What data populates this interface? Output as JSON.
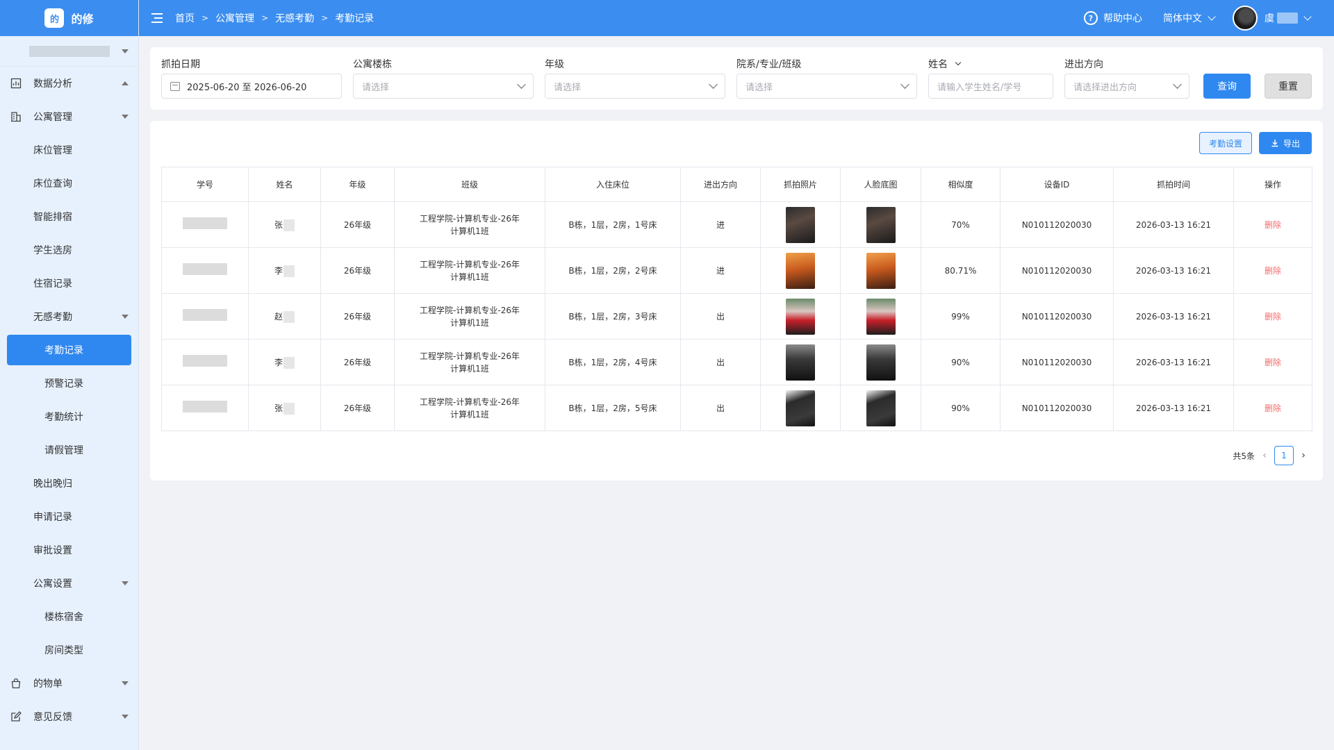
{
  "app": {
    "logo_icon": "的",
    "name": "的修"
  },
  "colors": {
    "primary": "#2f88f0",
    "header": "#3b8ef0",
    "danger": "#f56c6c",
    "sidebar_bg": "#e7f1fd"
  },
  "breadcrumb": [
    "首页",
    "公寓管理",
    "无感考勤",
    "考勤记录"
  ],
  "header": {
    "help": "帮助中心",
    "language": "简体中文",
    "user_name": "虞"
  },
  "sidebar": {
    "items": [
      {
        "label": "数据分析",
        "level": 1,
        "icon": "chart-icon",
        "expanded": true
      },
      {
        "label": "公寓管理",
        "level": 1,
        "icon": "building-icon",
        "expanded": true
      },
      {
        "label": "床位管理",
        "level": 1
      },
      {
        "label": "床位查询",
        "level": 1
      },
      {
        "label": "智能排宿",
        "level": 1
      },
      {
        "label": "学生选房",
        "level": 1
      },
      {
        "label": "住宿记录",
        "level": 1
      },
      {
        "label": "无感考勤",
        "level": 1,
        "expanded": true
      },
      {
        "label": "考勤记录",
        "level": 2,
        "active": true
      },
      {
        "label": "预警记录",
        "level": 2
      },
      {
        "label": "考勤统计",
        "level": 2
      },
      {
        "label": "请假管理",
        "level": 2
      },
      {
        "label": "晚出晚归",
        "level": 1
      },
      {
        "label": "申请记录",
        "level": 1
      },
      {
        "label": "审批设置",
        "level": 1
      },
      {
        "label": "公寓设置",
        "level": 1,
        "expanded": true
      },
      {
        "label": "楼栋宿舍",
        "level": 2
      },
      {
        "label": "房间类型",
        "level": 2
      },
      {
        "label": "的物单",
        "level": 1,
        "icon": "bag-icon",
        "expanded": false
      },
      {
        "label": "意见反馈",
        "level": 1,
        "icon": "edit-icon",
        "expanded": false
      }
    ]
  },
  "filters": {
    "capture_date": {
      "label": "抓拍日期",
      "value": "2025-06-20 至 2026-06-20"
    },
    "building": {
      "label": "公寓楼栋",
      "placeholder": "请选择"
    },
    "grade": {
      "label": "年级",
      "placeholder": "请选择"
    },
    "dept": {
      "label": "院系/专业/班级",
      "placeholder": "请选择"
    },
    "name": {
      "label": "姓名",
      "placeholder": "请输入学生姓名/学号"
    },
    "direction": {
      "label": "进出方向",
      "placeholder": "请选择进出方向"
    },
    "search_button": "查询",
    "reset_button": "重置"
  },
  "toolbar": {
    "settings_button": "考勤设置",
    "export_button": "导出"
  },
  "table": {
    "columns": [
      "学号",
      "姓名",
      "年级",
      "班级",
      "入住床位",
      "进出方向",
      "抓拍照片",
      "人脸底图",
      "相似度",
      "设备ID",
      "抓拍时间",
      "操作"
    ],
    "rows": [
      {
        "surname": "张",
        "grade": "26年级",
        "class_line1": "工程学院-计算机专业-26年",
        "class_line2": "计算机1班",
        "bed": "B栋，1层，2房，1号床",
        "direction": "进",
        "similarity": "70%",
        "device": "N010112020030",
        "time": "2026-03-13 16:21",
        "action": "删除",
        "photo": "portrait-dark"
      },
      {
        "surname": "李",
        "grade": "26年级",
        "class_line1": "工程学院-计算机专业-26年",
        "class_line2": "计算机1班",
        "bed": "B栋，1层，2房，2号床",
        "direction": "进",
        "similarity": "80.71%",
        "device": "N010112020030",
        "time": "2026-03-13 16:21",
        "action": "删除",
        "photo": "portrait-sunset"
      },
      {
        "surname": "赵",
        "grade": "26年级",
        "class_line1": "工程学院-计算机专业-26年",
        "class_line2": "计算机1班",
        "bed": "B栋，1层，2房，3号床",
        "direction": "出",
        "similarity": "99%",
        "device": "N010112020030",
        "time": "2026-03-13 16:21",
        "action": "删除",
        "photo": "portrait-red"
      },
      {
        "surname": "李",
        "grade": "26年级",
        "class_line1": "工程学院-计算机专业-26年",
        "class_line2": "计算机1班",
        "bed": "B栋，1层，2房，4号床",
        "direction": "出",
        "similarity": "90%",
        "device": "N010112020030",
        "time": "2026-03-13 16:21",
        "action": "删除",
        "photo": "portrait-black"
      },
      {
        "surname": "张",
        "grade": "26年级",
        "class_line1": "工程学院-计算机专业-26年",
        "class_line2": "计算机1班",
        "bed": "B栋，1层，2房，5号床",
        "direction": "出",
        "similarity": "90%",
        "device": "N010112020030",
        "time": "2026-03-13 16:21",
        "action": "删除",
        "photo": "portrait-flower"
      }
    ]
  },
  "pagination": {
    "total": "共5条",
    "current_page": "1"
  }
}
